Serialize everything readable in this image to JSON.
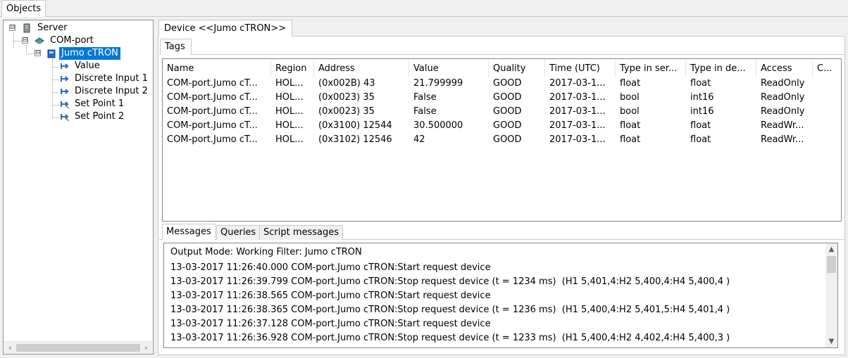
{
  "top_tab": {
    "label": "Objects"
  },
  "tree": {
    "server": "Server",
    "com_port": "COM-port",
    "device": "Jumo cTRON",
    "tags": [
      "Value",
      "Discrete Input 1",
      "Discrete Input 2",
      "Set Point 1",
      "Set Point 2"
    ],
    "expander_symbol": "⊟"
  },
  "device_tab": {
    "label": "Device <<Jumo cTRON>>"
  },
  "tags_tab": {
    "label": "Tags"
  },
  "table": {
    "columns": [
      "Name",
      "Region",
      "Address",
      "Value",
      "Quality",
      "Time (UTC)",
      "Type in ser...",
      "Type in de...",
      "Access",
      "C..."
    ],
    "rows": [
      [
        "COM-port.Jumo cT...",
        "HOL...",
        "(0x002B) 43",
        "21.799999",
        "GOOD",
        "2017-03-1...",
        "float",
        "float",
        "ReadOnly",
        ""
      ],
      [
        "COM-port.Jumo cT...",
        "HOL...",
        "(0x0023) 35",
        "False",
        "GOOD",
        "2017-03-1...",
        "bool",
        "int16",
        "ReadOnly",
        ""
      ],
      [
        "COM-port.Jumo cT...",
        "HOL...",
        "(0x0023) 35",
        "False",
        "GOOD",
        "2017-03-1...",
        "bool",
        "int16",
        "ReadOnly",
        ""
      ],
      [
        "COM-port.Jumo cT...",
        "HOL...",
        "(0x3100) 12544",
        "30.500000",
        "GOOD",
        "2017-03-1...",
        "float",
        "float",
        "ReadWr...",
        ""
      ],
      [
        "COM-port.Jumo cT...",
        "HOL...",
        "(0x3102) 12546",
        "42",
        "GOOD",
        "2017-03-1...",
        "float",
        "float",
        "ReadWr...",
        ""
      ]
    ]
  },
  "message_tabs": [
    "Messages",
    "Queries",
    "Script messages"
  ],
  "messages": {
    "header": "Output Mode: Working Filter: Jumo cTRON",
    "lines": [
      "13-03-2017 11:26:40.000 COM-port.Jumo cTRON:Start request device",
      "13-03-2017 11:26:39.799 COM-port.Jumo cTRON:Stop request device (t = 1234 ms)  (H1 5,401,4:H2 5,400,4:H4 5,400,4 )",
      "13-03-2017 11:26:38.565 COM-port.Jumo cTRON:Start request device",
      "13-03-2017 11:26:38.365 COM-port.Jumo cTRON:Stop request device (t = 1236 ms)  (H1 5,400,4:H2 5,401,5:H4 5,401,4 )",
      "13-03-2017 11:26:37.128 COM-port.Jumo cTRON:Start request device",
      "13-03-2017 11:26:36.928 COM-port.Jumo cTRON:Stop request device (t = 1233 ms)  (H1 5,400,4:H2 4,402,4:H4 5,400,3 )"
    ]
  },
  "colors": {
    "selection": "#0078d7",
    "border": "#828790",
    "tag_icon": "#1f6fbf"
  }
}
